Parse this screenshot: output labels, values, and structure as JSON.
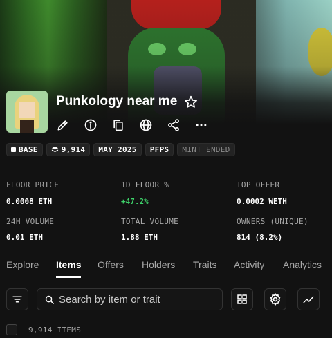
{
  "collection": {
    "name": "Punkology near me",
    "actions": [
      "edit-icon",
      "info-icon",
      "copy-icon",
      "globe-icon",
      "share-icon",
      "more-icon"
    ]
  },
  "tags": [
    {
      "icon": "square-icon",
      "label": "BASE"
    },
    {
      "icon": "stack-icon",
      "label": "9,914"
    },
    {
      "label": "MAY 2025"
    },
    {
      "label": "PFPS"
    },
    {
      "label": "MINT ENDED"
    }
  ],
  "stats": {
    "floor_price": {
      "label": "FLOOR PRICE",
      "value": "0.0008 ETH"
    },
    "floor_1d": {
      "label": "1D FLOOR %",
      "value": "+47.2%"
    },
    "top_offer": {
      "label": "TOP OFFER",
      "value": "0.0002 WETH"
    },
    "volume_24h": {
      "label": "24H VOLUME",
      "value": "0.01 ETH"
    },
    "total_volume": {
      "label": "TOTAL VOLUME",
      "value": "1.88 ETH"
    },
    "owners": {
      "label": "OWNERS (UNIQUE)",
      "value": "814 (8.2%)"
    }
  },
  "tabs": [
    "Explore",
    "Items",
    "Offers",
    "Holders",
    "Traits",
    "Activity",
    "Analytics"
  ],
  "active_tab": "Items",
  "search": {
    "placeholder": "Search by item or trait"
  },
  "items_count": "9,914 ITEMS",
  "colors": {
    "positive": "#3ed26a",
    "background": "#121212"
  }
}
